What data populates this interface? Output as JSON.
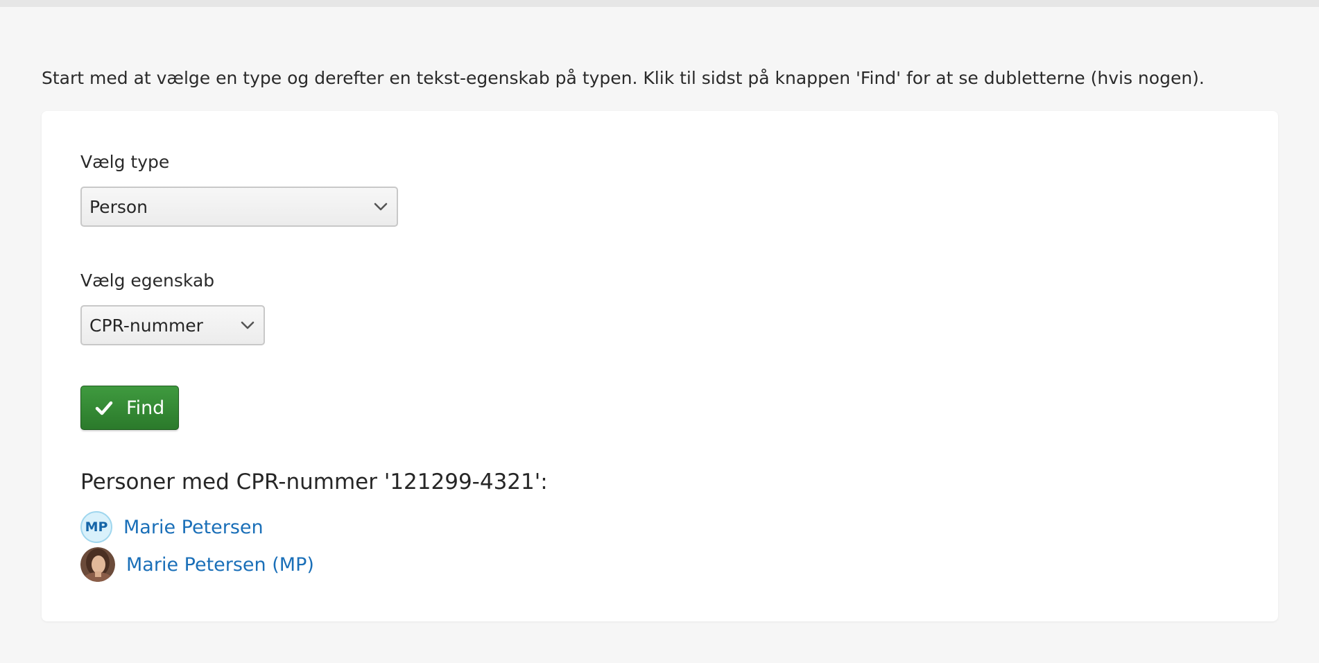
{
  "intro_text": "Start med at vælge en type og derefter en tekst-egenskab på typen. Klik til sidst på knappen 'Find' for at se dubletterne (hvis nogen).",
  "form": {
    "type_label": "Vælg type",
    "type_value": "Person",
    "property_label": "Vælg egenskab",
    "property_value": "CPR-nummer",
    "find_button_label": "Find",
    "find_button_icon": "checkmark-icon",
    "find_button_color": "#348a34"
  },
  "results": {
    "heading": "Personer med CPR-nummer '121299-4321':",
    "items": [
      {
        "avatar_type": "initials",
        "initials": "MP",
        "name": "Marie Petersen"
      },
      {
        "avatar_type": "photo",
        "name": "Marie Petersen (MP)"
      }
    ]
  },
  "colors": {
    "link": "#1a6fb8",
    "background": "#f6f6f6",
    "card": "#ffffff"
  }
}
